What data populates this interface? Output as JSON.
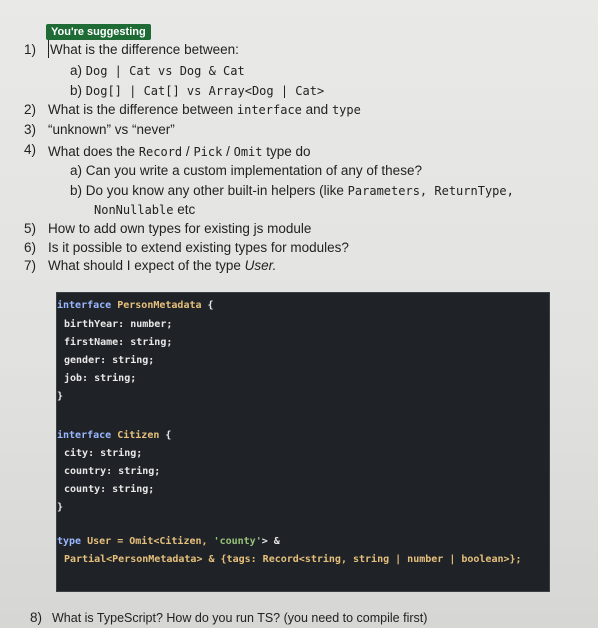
{
  "badge": "You're suggesting",
  "q1": {
    "num": "1)",
    "text": "What is the difference between:",
    "a_label": "a)",
    "a_code": "Dog | Cat vs Dog & Cat",
    "b_label": "b)",
    "b_code": "Dog[] | Cat[] vs Array<Dog | Cat>"
  },
  "q2": {
    "num": "2)",
    "pre": "What is the difference between ",
    "c1": "interface",
    "mid": " and ",
    "c2": "type"
  },
  "q3": {
    "num": "3)",
    "text": "“unknown” vs “never”"
  },
  "q4": {
    "num": "4)",
    "pre": "What does the ",
    "c1": "Record",
    "s1": " / ",
    "c2": "Pick",
    "s2": " / ",
    "c3": "Omit",
    "post": " type do",
    "a_label": "a)",
    "a_text": "Can you write a custom implementation of any of these?",
    "b_label": "b)",
    "b_pre": "Do you know any other built-in helpers (like ",
    "b_code": "Parameters, ReturnType,",
    "b_cont": "NonNullable",
    "b_etc": " etc"
  },
  "q5": {
    "num": "5)",
    "text": "How to add own types for existing js module"
  },
  "q6": {
    "num": "6)",
    "text": "Is it possible to extend existing types for modules?"
  },
  "q7": {
    "num": "7)",
    "pre": "What should I expect of the type ",
    "em": "User."
  },
  "code": {
    "l1_kw": "interface",
    "l1_name": "PersonMetadata",
    "l1_brace": " {",
    "l2": "birthYear: number;",
    "l3": "firstName: string;",
    "l4": "gender: string;",
    "l5": "job: string;",
    "l6": "}",
    "l7_kw": "interface",
    "l7_name": "Citizen",
    "l7_brace": " {",
    "l8": "city: string;",
    "l9": "country: string;",
    "l10": "county: string;",
    "l11": "}",
    "l12_kw": "type",
    "l12_rest": " User = Omit<Citizen, ",
    "l12_str": "'county'",
    "l12_end": "> &",
    "l13": "Partial<PersonMetadata> & {tags: Record<string, string | number | boolean>};"
  },
  "q8": {
    "num": "8)",
    "text": "What is TypeScript? How do you run TS? (you need to compile first)"
  }
}
